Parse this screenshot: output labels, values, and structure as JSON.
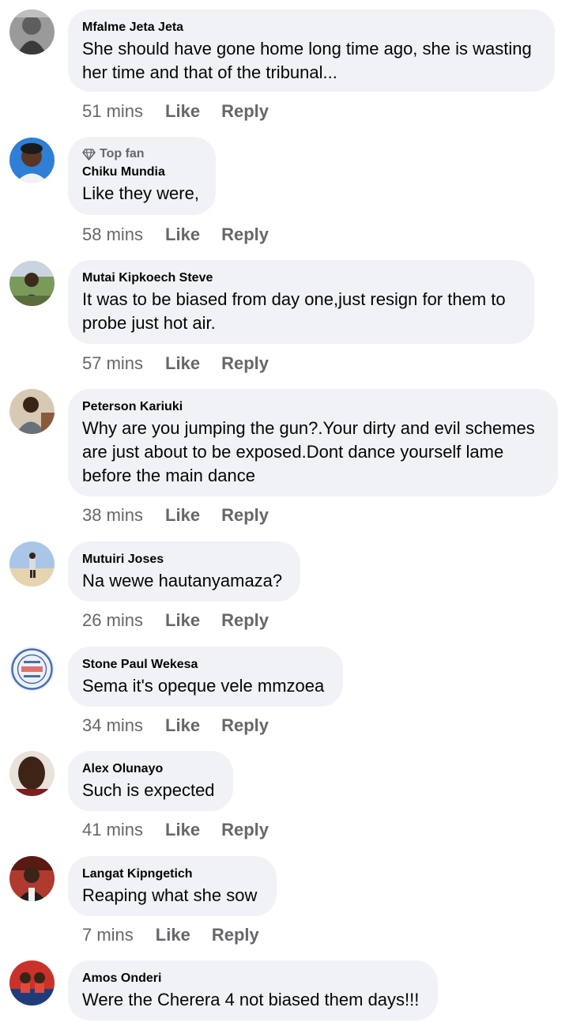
{
  "comments": [
    {
      "author": "Mfalme Jeta Jeta",
      "top_fan": false,
      "text": "She should have gone home long time ago, she is wasting her time and that of the tribunal...",
      "time": "51 mins",
      "like_label": "Like",
      "reply_label": "Reply"
    },
    {
      "author": "Chiku Mundia",
      "top_fan": true,
      "badge": "Top fan",
      "badge_icon": "diamond-icon",
      "text": "Like they were,",
      "time": "58 mins",
      "like_label": "Like",
      "reply_label": "Reply"
    },
    {
      "author": "Mutai Kipkoech Steve",
      "top_fan": false,
      "text": "It was to be biased from day one,just resign for them to probe just hot air.",
      "time": "57 mins",
      "like_label": "Like",
      "reply_label": "Reply"
    },
    {
      "author": "Peterson Kariuki",
      "top_fan": false,
      "text": "Why are you jumping the gun?.Your dirty and evil schemes are just about to be exposed.Dont dance yourself lame before the main dance",
      "time": "38 mins",
      "like_label": "Like",
      "reply_label": "Reply"
    },
    {
      "author": "Mutuiri Joses",
      "top_fan": false,
      "text": "Na wewe hautanyamaza?",
      "time": "26 mins",
      "like_label": "Like",
      "reply_label": "Reply"
    },
    {
      "author": "Stone Paul Wekesa",
      "top_fan": false,
      "text": "Sema it's opeque vele mmzoea",
      "time": "34 mins",
      "like_label": "Like",
      "reply_label": "Reply"
    },
    {
      "author": "Alex Olunayo",
      "top_fan": false,
      "text": "Such is expected",
      "time": "41 mins",
      "like_label": "Like",
      "reply_label": "Reply"
    },
    {
      "author": "Langat Kipngetich",
      "top_fan": false,
      "text": "Reaping what she sow",
      "time": "7 mins",
      "like_label": "Like",
      "reply_label": "Reply"
    },
    {
      "author": "Amos Onderi",
      "top_fan": false,
      "text": "Were the Cherera 4 not biased them days!!!",
      "time": "",
      "like_label": "",
      "reply_label": ""
    }
  ],
  "colors": {
    "bubble_bg": "#f0f2f5",
    "secondary_text": "#65676b",
    "primary_text": "#050505"
  }
}
